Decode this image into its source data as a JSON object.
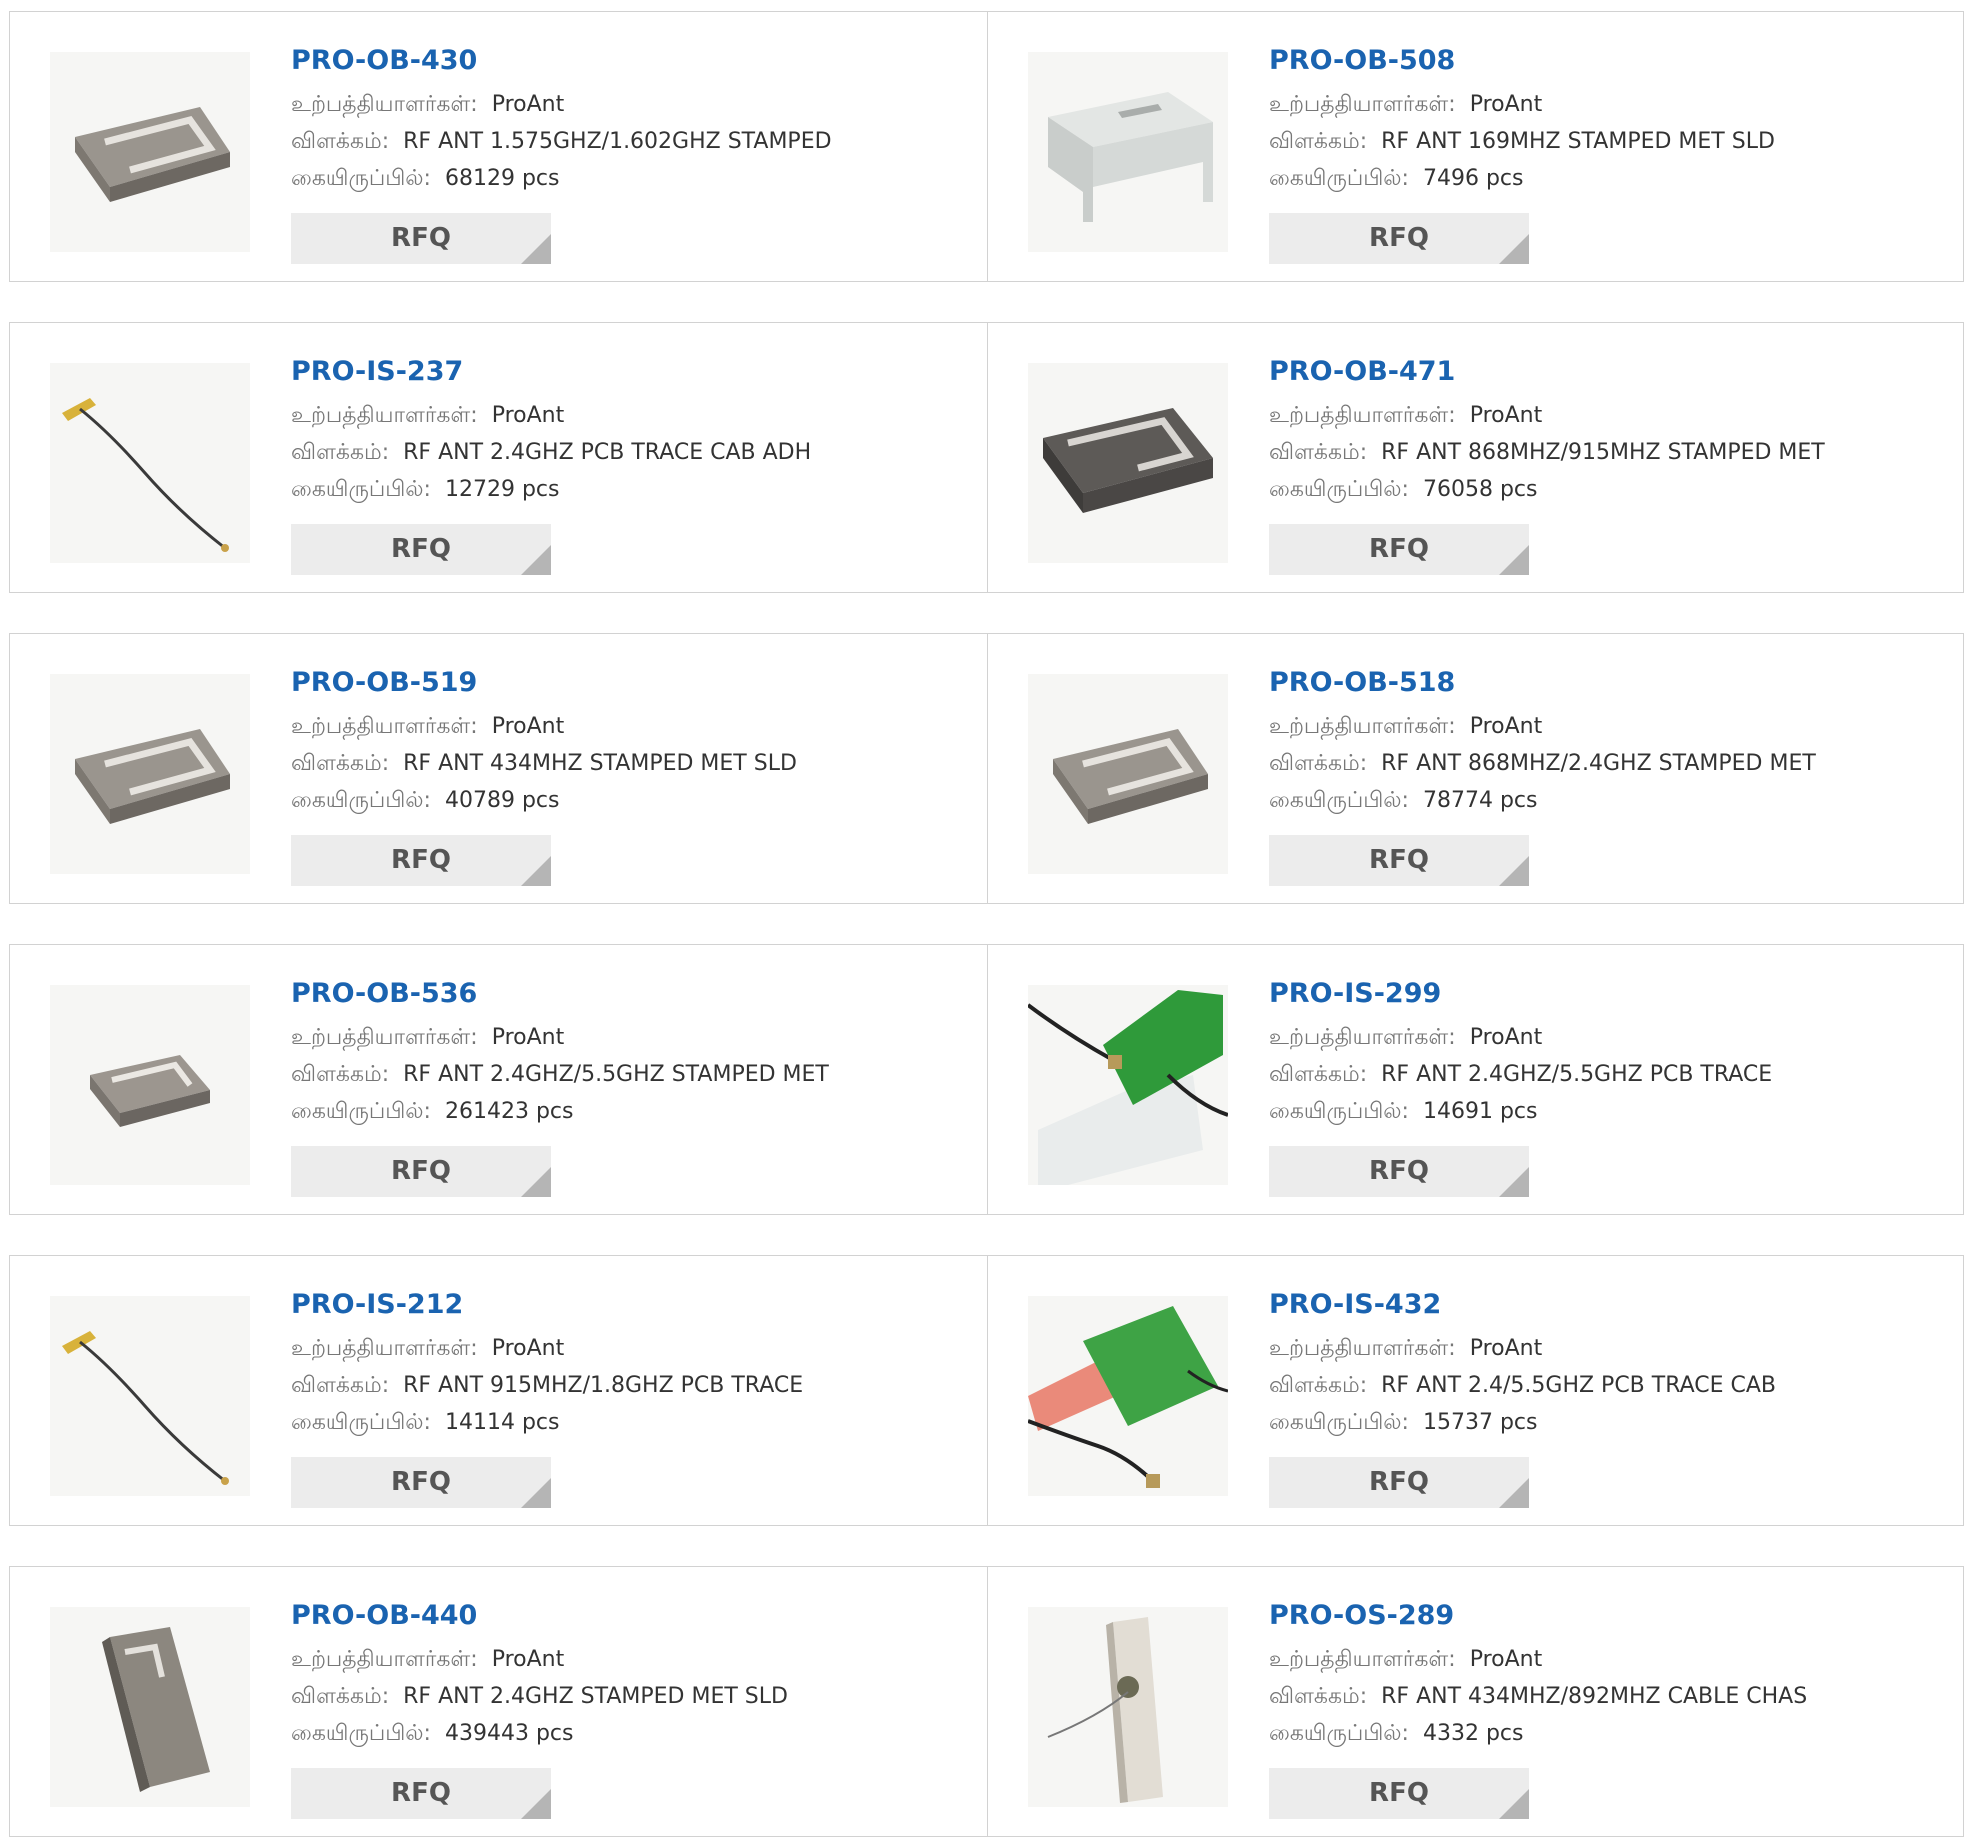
{
  "labels": {
    "manufacturer": "உற்பத்தியாளர்கள்:",
    "description": "விளக்கம்:",
    "stock": "கையிருப்பில்:",
    "rfq": "RFQ"
  },
  "colors": {
    "part_link": "#1a63b0",
    "label_text": "#777777",
    "value_text": "#333333",
    "rfq_bg": "#ececec",
    "border": "#d2d2d2"
  },
  "products": [
    {
      "part": "PRO-OB-430",
      "manufacturer": "ProAnt",
      "description": "RF ANT 1.575GHZ/1.602GHZ STAMPED",
      "stock": "68129 pcs",
      "image": "stamped-metal-antenna"
    },
    {
      "part": "PRO-OB-508",
      "manufacturer": "ProAnt",
      "description": "RF ANT 169MHZ STAMPED MET SLD",
      "stock": "7496 pcs",
      "image": "white-stamped-bracket-antenna"
    },
    {
      "part": "PRO-IS-237",
      "manufacturer": "ProAnt",
      "description": "RF ANT 2.4GHZ PCB TRACE CAB ADH",
      "stock": "12729 pcs",
      "image": "pcb-cable-antenna"
    },
    {
      "part": "PRO-OB-471",
      "manufacturer": "ProAnt",
      "description": "RF ANT 868MHZ/915MHZ STAMPED MET",
      "stock": "76058 pcs",
      "image": "dark-stamped-metal-antenna"
    },
    {
      "part": "PRO-OB-519",
      "manufacturer": "ProAnt",
      "description": "RF ANT 434MHZ STAMPED MET SLD",
      "stock": "40789 pcs",
      "image": "stamped-metal-antenna"
    },
    {
      "part": "PRO-OB-518",
      "manufacturer": "ProAnt",
      "description": "RF ANT 868MHZ/2.4GHZ STAMPED MET",
      "stock": "78774 pcs",
      "image": "stamped-metal-antenna"
    },
    {
      "part": "PRO-OB-536",
      "manufacturer": "ProAnt",
      "description": "RF ANT 2.4GHZ/5.5GHZ STAMPED MET",
      "stock": "261423 pcs",
      "image": "small-stamped-metal-antenna"
    },
    {
      "part": "PRO-IS-299",
      "manufacturer": "ProAnt",
      "description": "RF ANT 2.4GHZ/5.5GHZ PCB TRACE",
      "stock": "14691 pcs",
      "image": "green-pcb-triangle-antenna"
    },
    {
      "part": "PRO-IS-212",
      "manufacturer": "ProAnt",
      "description": "RF ANT 915MHZ/1.8GHZ PCB TRACE",
      "stock": "14114 pcs",
      "image": "pcb-cable-antenna"
    },
    {
      "part": "PRO-IS-432",
      "manufacturer": "ProAnt",
      "description": "RF ANT 2.4/5.5GHZ PCB TRACE CAB",
      "stock": "15737 pcs",
      "image": "green-pcb-square-antenna"
    },
    {
      "part": "PRO-OB-440",
      "manufacturer": "ProAnt",
      "description": "RF ANT 2.4GHZ STAMPED MET SLD",
      "stock": "439443 pcs",
      "image": "tilted-stamped-metal-antenna"
    },
    {
      "part": "PRO-OS-289",
      "manufacturer": "ProAnt",
      "description": "RF ANT 434MHZ/892MHZ CABLE CHAS",
      "stock": "4332 pcs",
      "image": "chassis-cable-antenna"
    }
  ]
}
